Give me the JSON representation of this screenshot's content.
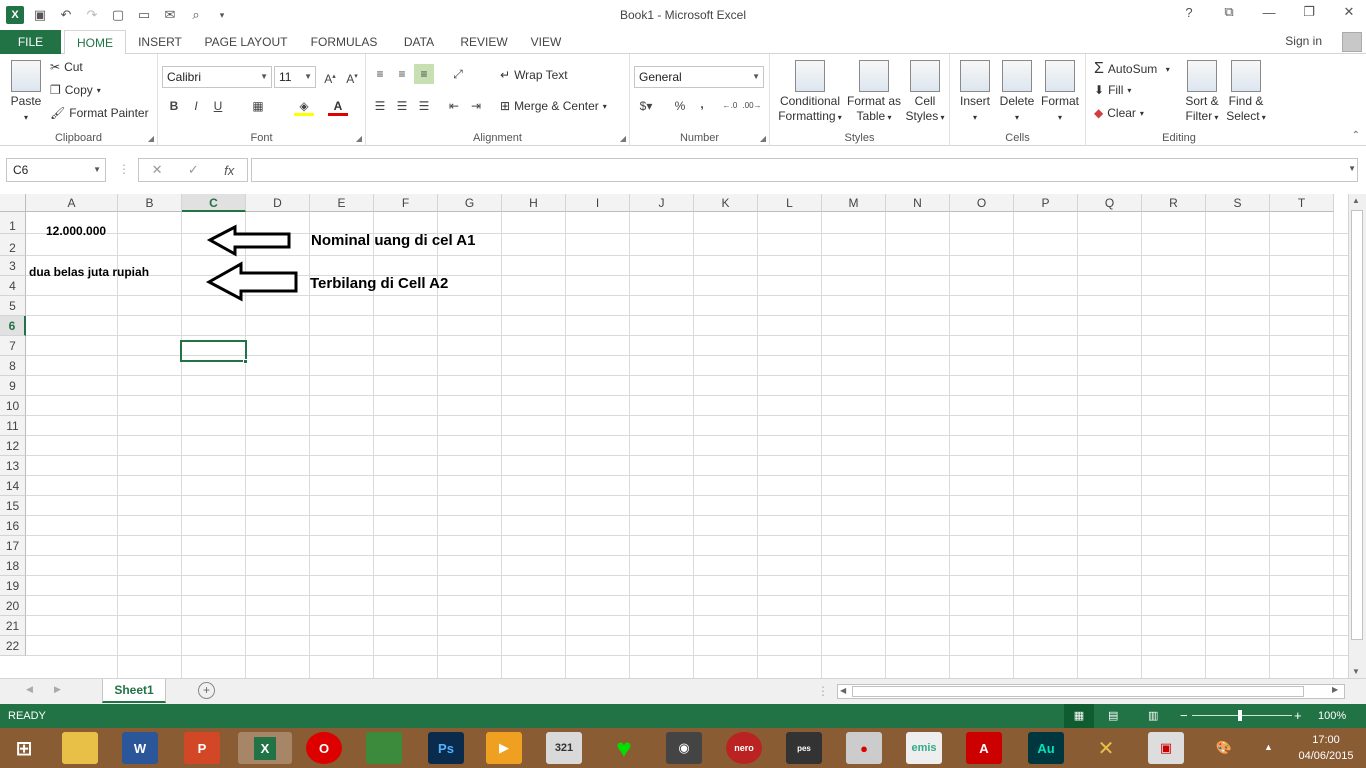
{
  "window": {
    "title": "Book1 - Microsoft Excel",
    "help": "?",
    "minimize": "—",
    "restore": "❐",
    "close": "✕",
    "ribbon_display": "⧉"
  },
  "tabs": [
    {
      "label": "FILE"
    },
    {
      "label": "HOME"
    },
    {
      "label": "INSERT"
    },
    {
      "label": "PAGE LAYOUT"
    },
    {
      "label": "FORMULAS"
    },
    {
      "label": "DATA"
    },
    {
      "label": "REVIEW"
    },
    {
      "label": "VIEW"
    }
  ],
  "account": {
    "sign_in": "Sign in"
  },
  "ribbon": {
    "clipboard": {
      "label": "Clipboard",
      "paste": "Paste",
      "cut": "Cut",
      "copy": "Copy",
      "format_painter": "Format Painter"
    },
    "font": {
      "label": "Font",
      "name": "Calibri",
      "size": "11",
      "bold": "B",
      "italic": "I",
      "underline": "U"
    },
    "alignment": {
      "label": "Alignment",
      "wrap_text": "Wrap Text",
      "merge_center": "Merge & Center"
    },
    "number": {
      "label": "Number",
      "format": "General",
      "percent": "%",
      "comma": ","
    },
    "styles": {
      "label": "Styles",
      "conditional_1": "Conditional",
      "conditional_2": "Formatting",
      "format_table_1": "Format as",
      "format_table_2": "Table",
      "cell_styles_1": "Cell",
      "cell_styles_2": "Styles"
    },
    "cells": {
      "label": "Cells",
      "insert": "Insert",
      "delete": "Delete",
      "format": "Format"
    },
    "editing": {
      "label": "Editing",
      "autosum": "AutoSum",
      "fill": "Fill",
      "clear": "Clear",
      "sort_1": "Sort &",
      "sort_2": "Filter",
      "find_1": "Find &",
      "find_2": "Select"
    }
  },
  "formula_bar": {
    "name_box": "C6",
    "fx": "fx",
    "cancel": "✕",
    "enter": "✓",
    "value": ""
  },
  "columns": [
    "A",
    "B",
    "C",
    "D",
    "E",
    "F",
    "G",
    "H",
    "I",
    "J",
    "K",
    "L",
    "M",
    "N",
    "O",
    "P",
    "Q",
    "R",
    "S",
    "T"
  ],
  "rows": [
    "1",
    "2",
    "3",
    "4",
    "5",
    "6",
    "7",
    "8",
    "9",
    "10",
    "11",
    "12",
    "13",
    "14",
    "15",
    "16",
    "17",
    "18",
    "19",
    "20",
    "21",
    "22"
  ],
  "selected_cell": "C6",
  "cells": {
    "A1": "12.000.000",
    "A2": "dua belas juta rupiah"
  },
  "annotations": {
    "a1_note": "Nominal uang di cel A1",
    "a2_note": "Terbilang di Cell A2"
  },
  "sheets": [
    {
      "name": "Sheet1",
      "active": true
    }
  ],
  "status": {
    "mode": "READY",
    "zoom": "100%"
  },
  "taskbar": {
    "time": "17:00",
    "date": "04/06/2015"
  },
  "colors": {
    "accent": "#217346",
    "taskbar": "#8a5c34"
  }
}
